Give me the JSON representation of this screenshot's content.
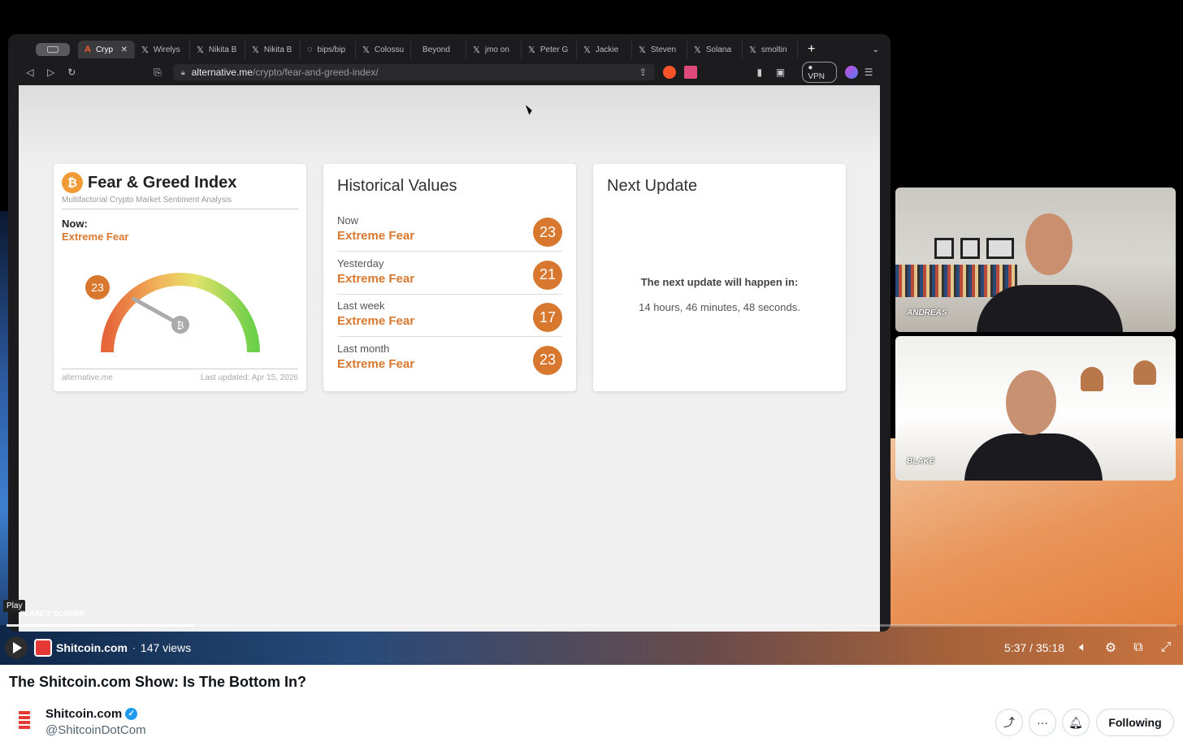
{
  "browser": {
    "tabs": [
      {
        "label": "Cryp",
        "icon": "A",
        "active": true
      },
      {
        "label": "Wirelys",
        "icon": "𝕏"
      },
      {
        "label": "Nikita B",
        "icon": "𝕏"
      },
      {
        "label": "Nikita B",
        "icon": "𝕏"
      },
      {
        "label": "bips/bip",
        "icon": "◌"
      },
      {
        "label": "Colossu",
        "icon": "𝕏"
      },
      {
        "label": "Beyond",
        "icon": ""
      },
      {
        "label": "jmo on",
        "icon": "𝕏"
      },
      {
        "label": "Peter G",
        "icon": "𝕏"
      },
      {
        "label": "Jackie",
        "icon": "𝕏"
      },
      {
        "label": "Steven",
        "icon": "𝕏"
      },
      {
        "label": "Solana",
        "icon": "𝕏"
      },
      {
        "label": "smoltin",
        "icon": "𝕏"
      }
    ],
    "url_host": "alternative.me",
    "url_path": "/crypto/fear-and-greed-index/",
    "vpn_label": "VPN"
  },
  "fear_greed": {
    "title": "Fear & Greed Index",
    "subtitle": "Multifactorial Crypto Market Sentiment Analysis",
    "now_label": "Now:",
    "now_classification": "Extreme Fear",
    "value": "23",
    "value_num": 23,
    "footer_left": "alternative.me",
    "footer_right": "Last updated: Apr 15, 2026"
  },
  "historical": {
    "title": "Historical Values",
    "rows": [
      {
        "label": "Now",
        "classification": "Extreme Fear",
        "value": "23"
      },
      {
        "label": "Yesterday",
        "classification": "Extreme Fear",
        "value": "21"
      },
      {
        "label": "Last week",
        "classification": "Extreme Fear",
        "value": "17"
      },
      {
        "label": "Last month",
        "classification": "Extreme Fear",
        "value": "23"
      }
    ]
  },
  "next_update": {
    "title": "Next Update",
    "heading": "The next update will happen in:",
    "countdown": "14 hours, 46 minutes, 48 seconds."
  },
  "video": {
    "screen_label": "BLAKE'S SCREEN",
    "play_tooltip": "Play",
    "participants": [
      "ANDREAS",
      "BLAKE"
    ],
    "channel": "Shitcoin.com",
    "separator": "·",
    "views": "147 views",
    "time": "5:37 / 35:18",
    "progress": 0.16
  },
  "post": {
    "title": "The Shitcoin.com Show: Is The Bottom In?",
    "account_name": "Shitcoin.com",
    "handle": "@ShitcoinDotCom",
    "follow_label": "Following"
  },
  "colors": {
    "accent": "#d8782f",
    "verified": "#1d9bf0"
  }
}
